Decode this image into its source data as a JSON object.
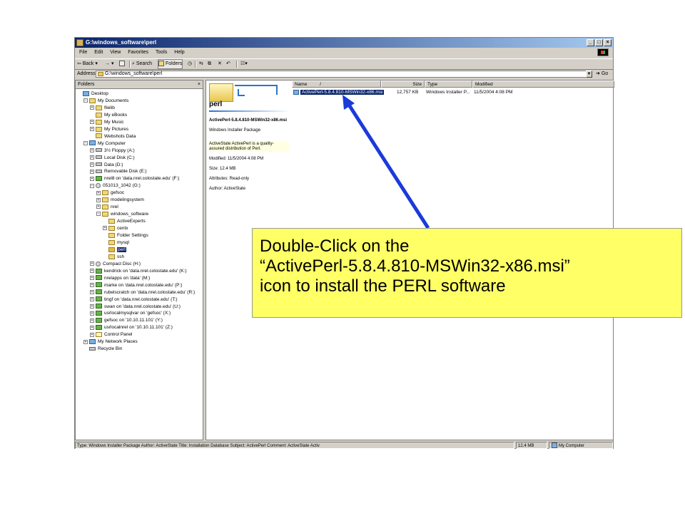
{
  "window": {
    "title": "G:\\windows_software\\perl",
    "controls": {
      "minimize": "_",
      "maximize": "□",
      "close": "×"
    }
  },
  "menu": [
    "File",
    "Edit",
    "View",
    "Favorites",
    "Tools",
    "Help"
  ],
  "toolbar": {
    "back": "Back",
    "forward": "→",
    "up": "↑",
    "search": "Search",
    "folders": "Folders",
    "history": "◷",
    "move_to": "⇆",
    "copy_to": "⧉",
    "delete": "✕",
    "undo": "↶",
    "views": "☷"
  },
  "address": {
    "label": "Address",
    "value": "G:\\windows_software\\perl",
    "go": "Go"
  },
  "folders_pane": {
    "header": "Folders",
    "close": "×",
    "tree": [
      {
        "label": "Desktop",
        "icon": "desktop-icon",
        "exp": ""
      },
      {
        "label": "My Documents",
        "icon": "folder-icon",
        "exp": "−"
      },
      {
        "label": "filelib",
        "icon": "folder-icon",
        "exp": "+"
      },
      {
        "label": "My eBooks",
        "icon": "folder-icon",
        "exp": ""
      },
      {
        "label": "My Music",
        "icon": "folder-icon",
        "exp": "+"
      },
      {
        "label": "My Pictures",
        "icon": "folder-icon",
        "exp": "+"
      },
      {
        "label": "Webshots Data",
        "icon": "folder-icon",
        "exp": ""
      },
      {
        "label": "My Computer",
        "icon": "computer-icon",
        "exp": "−"
      },
      {
        "label": "3½ Floppy (A:)",
        "icon": "floppy-icon",
        "exp": "+"
      },
      {
        "label": "Local Disk (C:)",
        "icon": "drive-icon",
        "exp": "+"
      },
      {
        "label": "Data (D:)",
        "icon": "drive-icon",
        "exp": "+"
      },
      {
        "label": "Removable Disk (E:)",
        "icon": "drive-icon",
        "exp": "+"
      },
      {
        "label": "nrel8 on 'data.nrel.colostate.edu' (F:)",
        "icon": "network-drive-icon",
        "exp": "+"
      },
      {
        "label": "051013_1042 (G:)",
        "icon": "cd-icon",
        "exp": "−"
      },
      {
        "label": "gefsoc",
        "icon": "folder-icon",
        "exp": "+"
      },
      {
        "label": "modelingsystem",
        "icon": "folder-icon",
        "exp": "+"
      },
      {
        "label": "nrel",
        "icon": "folder-icon",
        "exp": "+"
      },
      {
        "label": "windows_software",
        "icon": "folder-icon",
        "exp": "−"
      },
      {
        "label": "ActiveExperts",
        "icon": "folder-icon",
        "exp": ""
      },
      {
        "label": "centx",
        "icon": "folder-icon",
        "exp": "+"
      },
      {
        "label": "Folder Settings",
        "icon": "folder-icon",
        "exp": ""
      },
      {
        "label": "mysql",
        "icon": "folder-icon",
        "exp": ""
      },
      {
        "label": "perl",
        "icon": "folder-open-icon",
        "exp": ""
      },
      {
        "label": "ssh",
        "icon": "folder-icon",
        "exp": ""
      },
      {
        "label": "Compact Disc (H:)",
        "icon": "cd-icon",
        "exp": "+"
      },
      {
        "label": "kendrick on 'data.nrel.colostate.edu' (K:)",
        "icon": "network-drive-icon",
        "exp": "+"
      },
      {
        "label": "nrelapps on 'data' (M:)",
        "icon": "network-drive-icon",
        "exp": "+"
      },
      {
        "label": "marke on 'data.nrel.colostate.edu' (P:)",
        "icon": "network-drive-icon",
        "exp": "+"
      },
      {
        "label": "rubelscratch on 'data.nrel.colostate.edu' (R:)",
        "icon": "network-drive-icon",
        "exp": "+"
      },
      {
        "label": "tingf on 'data.nrel.colostate.edu' (T:)",
        "icon": "network-drive-icon",
        "exp": "+"
      },
      {
        "label": "swan on 'data.nrel.colostate.edu' (U:)",
        "icon": "network-drive-icon",
        "exp": "+"
      },
      {
        "label": "usrlocalmysqlvar on 'gefsoc' (X:)",
        "icon": "network-drive-icon",
        "exp": "+"
      },
      {
        "label": "gefsoc on '10.10.11.101' (Y:)",
        "icon": "network-drive-icon",
        "exp": "+"
      },
      {
        "label": "usrlocalnrel on '10.10.11.101' (Z:)",
        "icon": "network-drive-icon",
        "exp": "+"
      },
      {
        "label": "Control Panel",
        "icon": "control-panel-icon",
        "exp": "+"
      },
      {
        "label": "My Network Places",
        "icon": "network-places-icon",
        "exp": "+"
      },
      {
        "label": "Recycle Bin",
        "icon": "recycle-bin-icon",
        "exp": ""
      }
    ]
  },
  "webview": {
    "folder_name": "perl",
    "file_name": "ActivePerl-5.8.4.810-MSWin32-x86.msi",
    "file_type": "Windows Installer Package",
    "description": "ActiveState ActivePerl is a quality-assured distribution of Perl.",
    "modified": "Modified: 11/5/2004 4:08 PM",
    "size": "Size: 12.4 MB",
    "attributes": "Attributes: Read-only",
    "author": "Author: ActiveState"
  },
  "file_list": {
    "columns": {
      "name": "Name",
      "size": "Size",
      "type": "Type",
      "modified": "Modified"
    },
    "sort_indicator": "/",
    "rows": [
      {
        "name": "ActivePerl-5.8.4.810-MSWin32-x86.msi",
        "size": "12,757 KB",
        "type": "Windows Installer P...",
        "modified": "11/5/2004 4:08 PM"
      }
    ]
  },
  "status_bar": {
    "info": "Type: Windows Installer Package Author: ActiveState Title: Installation Database Subject: ActivePerl Comment: ActiveState Activ",
    "size": "12.4 MB",
    "zone": "My Computer"
  },
  "callout": {
    "line1": "Double-Click on the",
    "line2": "“ActivePerl-5.8.4.810-MSWin32-x86.msi”",
    "line3": "icon to install the PERL software",
    "background": "#ffff66",
    "arrow_color": "#1a3adb"
  }
}
